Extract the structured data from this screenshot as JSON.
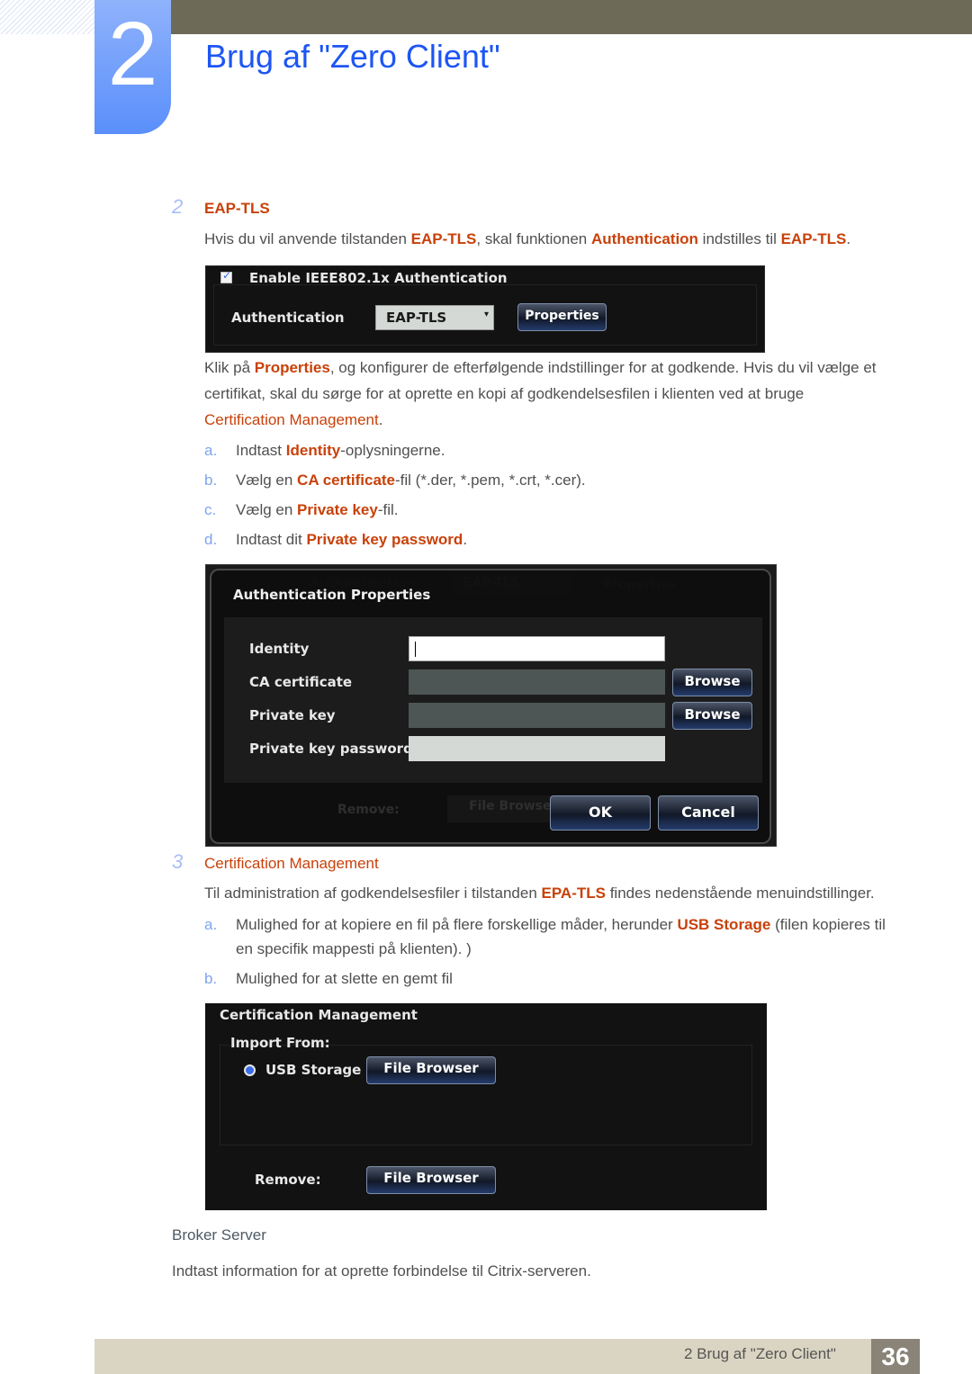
{
  "header": {
    "chapter_number": "2",
    "title": "Brug af \"Zero Client\""
  },
  "section2": {
    "number": "2",
    "heading": "EAP-TLS",
    "intro": {
      "t1": "Hvis du vil anvende tilstanden ",
      "h1": "EAP-TLS",
      "t2": ", skal funktionen ",
      "h2": "Authentication",
      "t3": " indstilles til ",
      "h3": "EAP-TLS",
      "t4": "."
    },
    "panel": {
      "checkbox_label": "Enable IEEE802.1x Authentication",
      "checkbox_checked": true,
      "auth_label": "Authentication",
      "auth_value": "EAP-TLS",
      "properties_button": "Properties"
    },
    "para2": {
      "t1": "Klik på ",
      "h1": "Properties",
      "t2": ", og konfigurer de efterfølgende indstillinger for at godkende. Hvis du vil vælge et",
      "line2": "certifikat, skal du sørge for at oprette en kopi af godkendelsesfilen i klienten ved at bruge",
      "h2": "Certification Management",
      "t3": "."
    },
    "list": [
      {
        "marker": "a.",
        "t1": "Indtast ",
        "h": "Identity",
        "t2": "-oplysningerne."
      },
      {
        "marker": "b.",
        "t1": "Vælg en ",
        "h": "CA certificate",
        "t2": "-fil (*.der, *.pem, *.crt, *.cer)."
      },
      {
        "marker": "c.",
        "t1": "Vælg en ",
        "h": "Private key",
        "t2": "-fil."
      },
      {
        "marker": "d.",
        "t1": "Indtast dit ",
        "h": "Private key password",
        "t2": "."
      }
    ],
    "dialog": {
      "bg_auth_label": "Authentication",
      "bg_auth_value": "EAP-TLS",
      "bg_properties": "Properties",
      "bg_remove": "Remove:",
      "bg_file_browser": "File Browse",
      "title": "Authentication Properties",
      "fields": {
        "identity_label": "Identity",
        "identity_value": "",
        "ca_label": "CA certificate",
        "ca_value": "",
        "private_key_label": "Private key",
        "private_key_value": "",
        "password_label": "Private key password",
        "password_value": ""
      },
      "browse_label": "Browse",
      "ok_label": "OK",
      "cancel_label": "Cancel"
    }
  },
  "section3": {
    "number": "3",
    "heading": "Certification Management",
    "intro": {
      "t1": "Til administration af godkendelsesfiler i tilstanden ",
      "h1": "EPA-TLS",
      "t2": " findes nedenstående menuindstillinger."
    },
    "list": [
      {
        "marker": "a.",
        "t1": "Mulighed for at kopiere en fil på flere forskellige måder, herunder ",
        "h": "USB Storage",
        "t2": " (filen kopieres til",
        "line2": "en specifik mappesti på klienten). )"
      },
      {
        "marker": "b.",
        "t1": "Mulighed for at slette en gemt fil"
      }
    ],
    "panel": {
      "title": "Certification Management",
      "import_label": "Import From:",
      "usb_label": "USB Storage",
      "usb_selected": true,
      "file_browser_label": "File Browser",
      "remove_label": "Remove:",
      "remove_file_browser_label": "File Browser"
    }
  },
  "broker": {
    "heading": "Broker Server",
    "text": "Indtast information for at oprette forbindelse til Citrix-serveren."
  },
  "footer": {
    "text": "2 Brug af \"Zero Client\"",
    "page": "36"
  },
  "colors": {
    "accent_blue": "#1d55f5",
    "highlight_orange": "#c8410a",
    "footer_bar": "#dad5c2",
    "page_badge": "#8a8378"
  }
}
